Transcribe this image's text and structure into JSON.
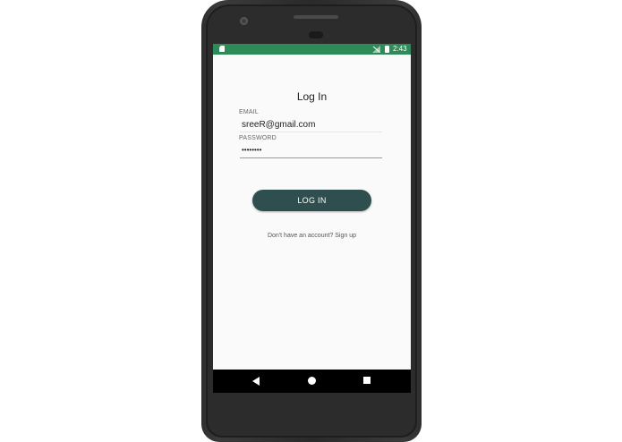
{
  "status_bar": {
    "time": "2:43",
    "color": "#2e8b57",
    "icons": [
      "sd-card-icon",
      "signal-icon",
      "battery-icon"
    ]
  },
  "login": {
    "title": "Log In",
    "email": {
      "label": "EMAIL",
      "value": "sreeR@gmail.com"
    },
    "password": {
      "label": "PASSWORD",
      "value": "••••••••"
    },
    "button_label": "LOG IN",
    "signup_text": "Don't have an account? Sign up",
    "button_color": "#2f4f4f"
  },
  "nav_bar": {
    "icons": [
      "back-icon",
      "home-icon",
      "recent-apps-icon"
    ]
  }
}
